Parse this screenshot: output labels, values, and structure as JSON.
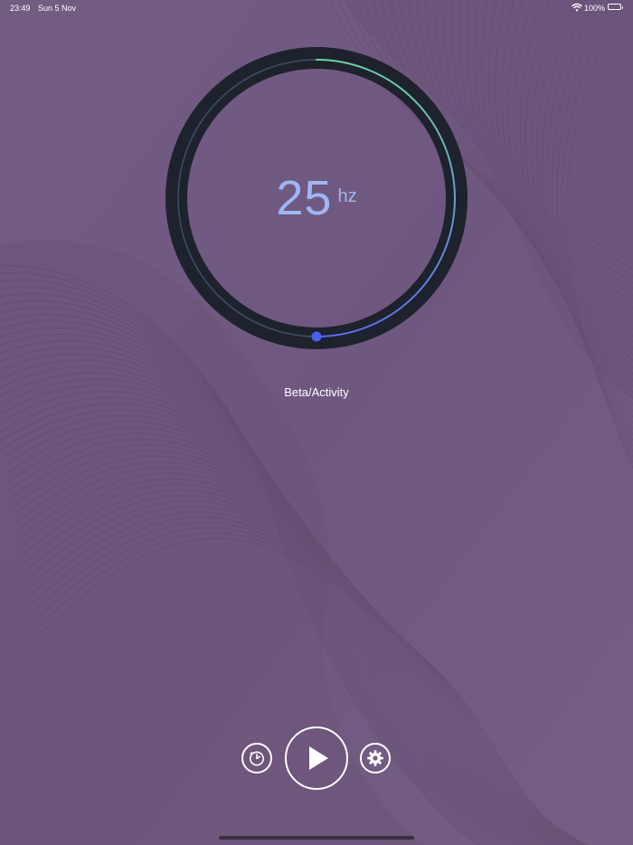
{
  "status_bar": {
    "time": "23:49",
    "date": "Sun 5 Nov",
    "battery_percent": "100%",
    "wifi_icon": "wifi-icon",
    "battery_icon": "battery-full-icon"
  },
  "dial": {
    "value": "25",
    "unit": "hz",
    "fraction": 0.5,
    "ring_color": "#1e222d",
    "track_color": "#3b4f66",
    "progress_color_start": "#6fd2a4",
    "progress_color_end": "#5a6ef0",
    "knob_color": "#4a5ff2"
  },
  "wave_name": "Beta/Activity",
  "controls": {
    "timer_icon": "timer-icon",
    "play_icon": "play-icon",
    "settings_icon": "gear-icon"
  },
  "colors": {
    "background": "#715a80",
    "frequency_text": "#9fb6f5"
  }
}
